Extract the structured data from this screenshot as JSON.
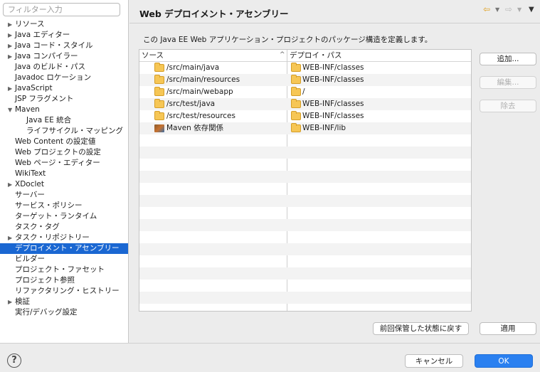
{
  "sidebar": {
    "filter_placeholder": "フィルター入力",
    "items": [
      {
        "label": "リソース",
        "expandable": true,
        "depth": 0
      },
      {
        "label": "Java エディター",
        "expandable": true,
        "depth": 0
      },
      {
        "label": "Java コード・スタイル",
        "expandable": true,
        "depth": 0
      },
      {
        "label": "Java コンパイラー",
        "expandable": true,
        "depth": 0
      },
      {
        "label": "Java のビルド・パス",
        "expandable": false,
        "depth": 0
      },
      {
        "label": "Javadoc ロケーション",
        "expandable": false,
        "depth": 0
      },
      {
        "label": "JavaScript",
        "expandable": true,
        "depth": 0
      },
      {
        "label": "JSP フラグメント",
        "expandable": false,
        "depth": 0
      },
      {
        "label": "Maven",
        "expandable": true,
        "expanded": true,
        "depth": 0
      },
      {
        "label": "Java EE 統合",
        "expandable": false,
        "depth": 1
      },
      {
        "label": "ライフサイクル・マッピング",
        "expandable": false,
        "depth": 1
      },
      {
        "label": "Web Content の設定値",
        "expandable": false,
        "depth": 0
      },
      {
        "label": "Web プロジェクトの設定",
        "expandable": false,
        "depth": 0
      },
      {
        "label": "Web ページ・エディター",
        "expandable": false,
        "depth": 0
      },
      {
        "label": "WikiText",
        "expandable": false,
        "depth": 0
      },
      {
        "label": "XDoclet",
        "expandable": true,
        "depth": 0
      },
      {
        "label": "サーバー",
        "expandable": false,
        "depth": 0
      },
      {
        "label": "サービス・ポリシー",
        "expandable": false,
        "depth": 0
      },
      {
        "label": "ターゲット・ランタイム",
        "expandable": false,
        "depth": 0
      },
      {
        "label": "タスク・タグ",
        "expandable": false,
        "depth": 0
      },
      {
        "label": "タスク・リポジトリー",
        "expandable": true,
        "depth": 0
      },
      {
        "label": "デプロイメント・アセンブリー",
        "expandable": false,
        "depth": 0,
        "selected": true
      },
      {
        "label": "ビルダー",
        "expandable": false,
        "depth": 0
      },
      {
        "label": "プロジェクト・ファセット",
        "expandable": false,
        "depth": 0
      },
      {
        "label": "プロジェクト参照",
        "expandable": false,
        "depth": 0
      },
      {
        "label": "リファクタリング・ヒストリー",
        "expandable": false,
        "depth": 0
      },
      {
        "label": "検証",
        "expandable": true,
        "depth": 0
      },
      {
        "label": "実行/デバッグ設定",
        "expandable": false,
        "depth": 0
      }
    ]
  },
  "header": {
    "title": "Web デプロイメント・アセンブリー",
    "back_icon": "back-arrow-icon",
    "forward_icon": "forward-arrow-icon",
    "menu_icon": "view-menu-icon"
  },
  "main": {
    "description": "この Java EE Web アプリケーション・プロジェクトのパッケージ構造を定義します。",
    "table": {
      "columns": {
        "source": "ソース",
        "deploy_path": "デプロイ・パス"
      },
      "rows": [
        {
          "source": "/src/main/java",
          "source_icon": "folder",
          "deploy": "WEB-INF/classes"
        },
        {
          "source": "/src/main/resources",
          "source_icon": "folder",
          "deploy": "WEB-INF/classes"
        },
        {
          "source": "/src/main/webapp",
          "source_icon": "folder",
          "deploy": "/"
        },
        {
          "source": "/src/test/java",
          "source_icon": "folder",
          "deploy": "WEB-INF/classes"
        },
        {
          "source": "/src/test/resources",
          "source_icon": "folder",
          "deploy": "WEB-INF/classes"
        },
        {
          "source": "Maven 依存関係",
          "source_icon": "maven-library",
          "deploy": "WEB-INF/lib"
        }
      ]
    },
    "buttons": {
      "add": "追加...",
      "edit": "編集...",
      "remove": "除去",
      "restore_defaults": "前回保管した状態に戻す",
      "apply": "適用"
    }
  },
  "footer": {
    "help": "?",
    "cancel": "キャンセル",
    "ok": "OK"
  },
  "colors": {
    "selection": "#1a67d2",
    "ok_button": "#2a80f0",
    "folder": "#f6c655"
  }
}
